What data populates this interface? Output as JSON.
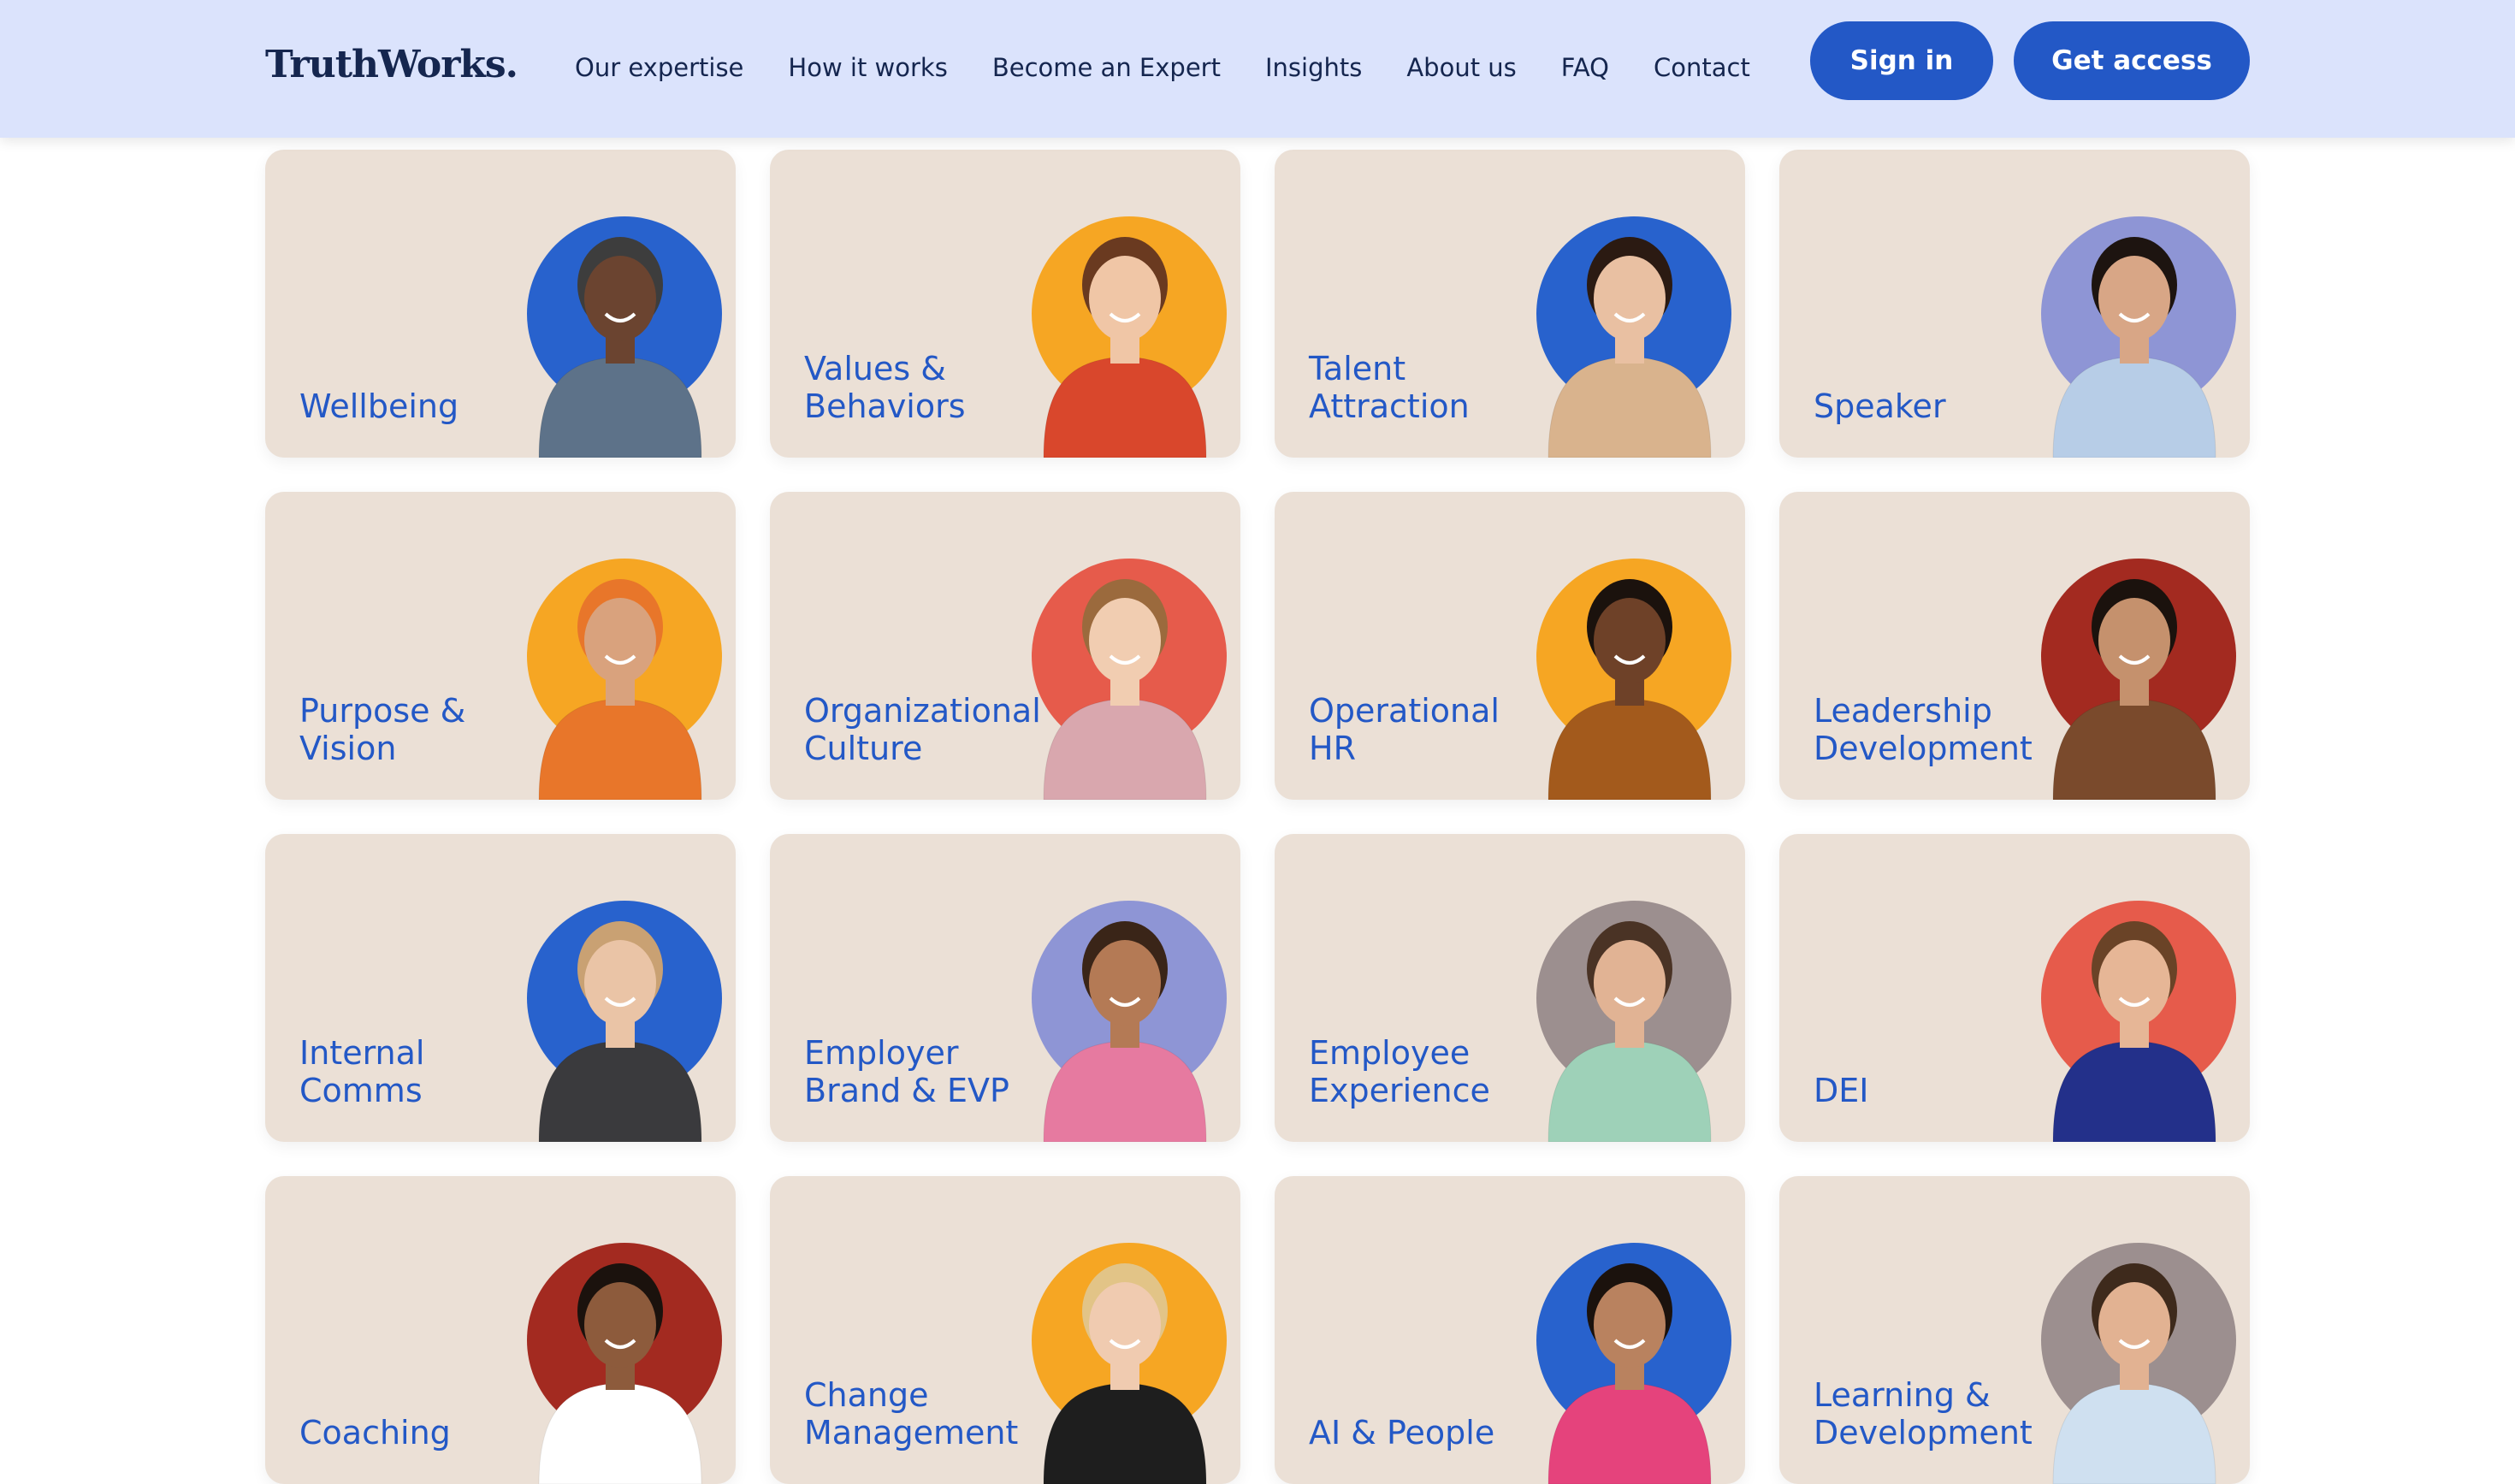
{
  "header": {
    "logo": "TruthWorks.",
    "nav": [
      "Our expertise",
      "How it works",
      "Become an Expert",
      "Insights",
      "About us",
      "FAQ",
      "Contact"
    ],
    "sign_in": "Sign in",
    "get_access": "Get access"
  },
  "colors": {
    "header_bg": "#dbe3fc",
    "brand_blue": "#2358c6",
    "navy": "#15264f",
    "card_bg": "#ebe0d6"
  },
  "cards": [
    {
      "lines": [
        "Wellbeing"
      ],
      "circle": "#2862cd",
      "shirt": "#5d7289",
      "skin": "#6b4430",
      "hair": "#3d3d3d"
    },
    {
      "lines": [
        "Values &",
        "Behaviors"
      ],
      "circle": "#f6a623",
      "shirt": "#d9472c",
      "skin": "#f0c6a6",
      "hair": "#6a3a20"
    },
    {
      "lines": [
        "Talent",
        "Attraction"
      ],
      "circle": "#2862cd",
      "shirt": "#d9b38d",
      "skin": "#e9c0a2",
      "hair": "#2b1a12"
    },
    {
      "lines": [
        "Speaker"
      ],
      "circle": "#8e95d5",
      "shirt": "#b7cde7",
      "skin": "#d8a686",
      "hair": "#1d1410"
    },
    {
      "lines": [
        "Purpose &",
        "Vision"
      ],
      "circle": "#f6a623",
      "shirt": "#e8762a",
      "skin": "#d9a27d",
      "hair": "#e8762a"
    },
    {
      "lines": [
        "Organizational",
        "Culture"
      ],
      "circle": "#e65b4b",
      "shirt": "#d9a7ae",
      "skin": "#f1cdb1",
      "hair": "#9b6a3d"
    },
    {
      "lines": [
        "Operational",
        "HR"
      ],
      "circle": "#f6a623",
      "shirt": "#a35a1c",
      "skin": "#6e4128",
      "hair": "#1b120d"
    },
    {
      "lines": [
        "Leadership",
        "Development"
      ],
      "circle": "#a32a20",
      "shirt": "#7a4a2c",
      "skin": "#c5916d",
      "hair": "#1b120d"
    },
    {
      "lines": [
        "Internal",
        "Comms"
      ],
      "circle": "#2862cd",
      "shirt": "#3a3a3d",
      "skin": "#eac4a6",
      "hair": "#c9a173"
    },
    {
      "lines": [
        "Employer",
        "Brand & EVP"
      ],
      "circle": "#8e95d5",
      "shirt": "#e67aa0",
      "skin": "#b47a55",
      "hair": "#3a2518"
    },
    {
      "lines": [
        "Employee",
        "Experience"
      ],
      "circle": "#9c8f8f",
      "shirt": "#9ed1b8",
      "skin": "#e1b394",
      "hair": "#4a3325"
    },
    {
      "lines": [
        "DEI"
      ],
      "circle": "#e65b4b",
      "shirt": "#23308a",
      "skin": "#e6b696",
      "hair": "#6a4327"
    },
    {
      "lines": [
        "Coaching"
      ],
      "circle": "#a32a20",
      "shirt": "#ffffff",
      "skin": "#8d5b3c",
      "hair": "#1b120d"
    },
    {
      "lines": [
        "Change",
        "Management"
      ],
      "circle": "#f6a623",
      "shirt": "#1e1e1e",
      "skin": "#f0cbb0",
      "hair": "#e2c487"
    },
    {
      "lines": [
        "AI & People"
      ],
      "circle": "#2862cd",
      "shirt": "#e5437c",
      "skin": "#b9825f",
      "hair": "#1b120d"
    },
    {
      "lines": [
        "Learning &",
        "Development"
      ],
      "circle": "#9c8f8f",
      "shirt": "#cfe0f0",
      "skin": "#e2b292",
      "hair": "#3e2a1c"
    }
  ]
}
